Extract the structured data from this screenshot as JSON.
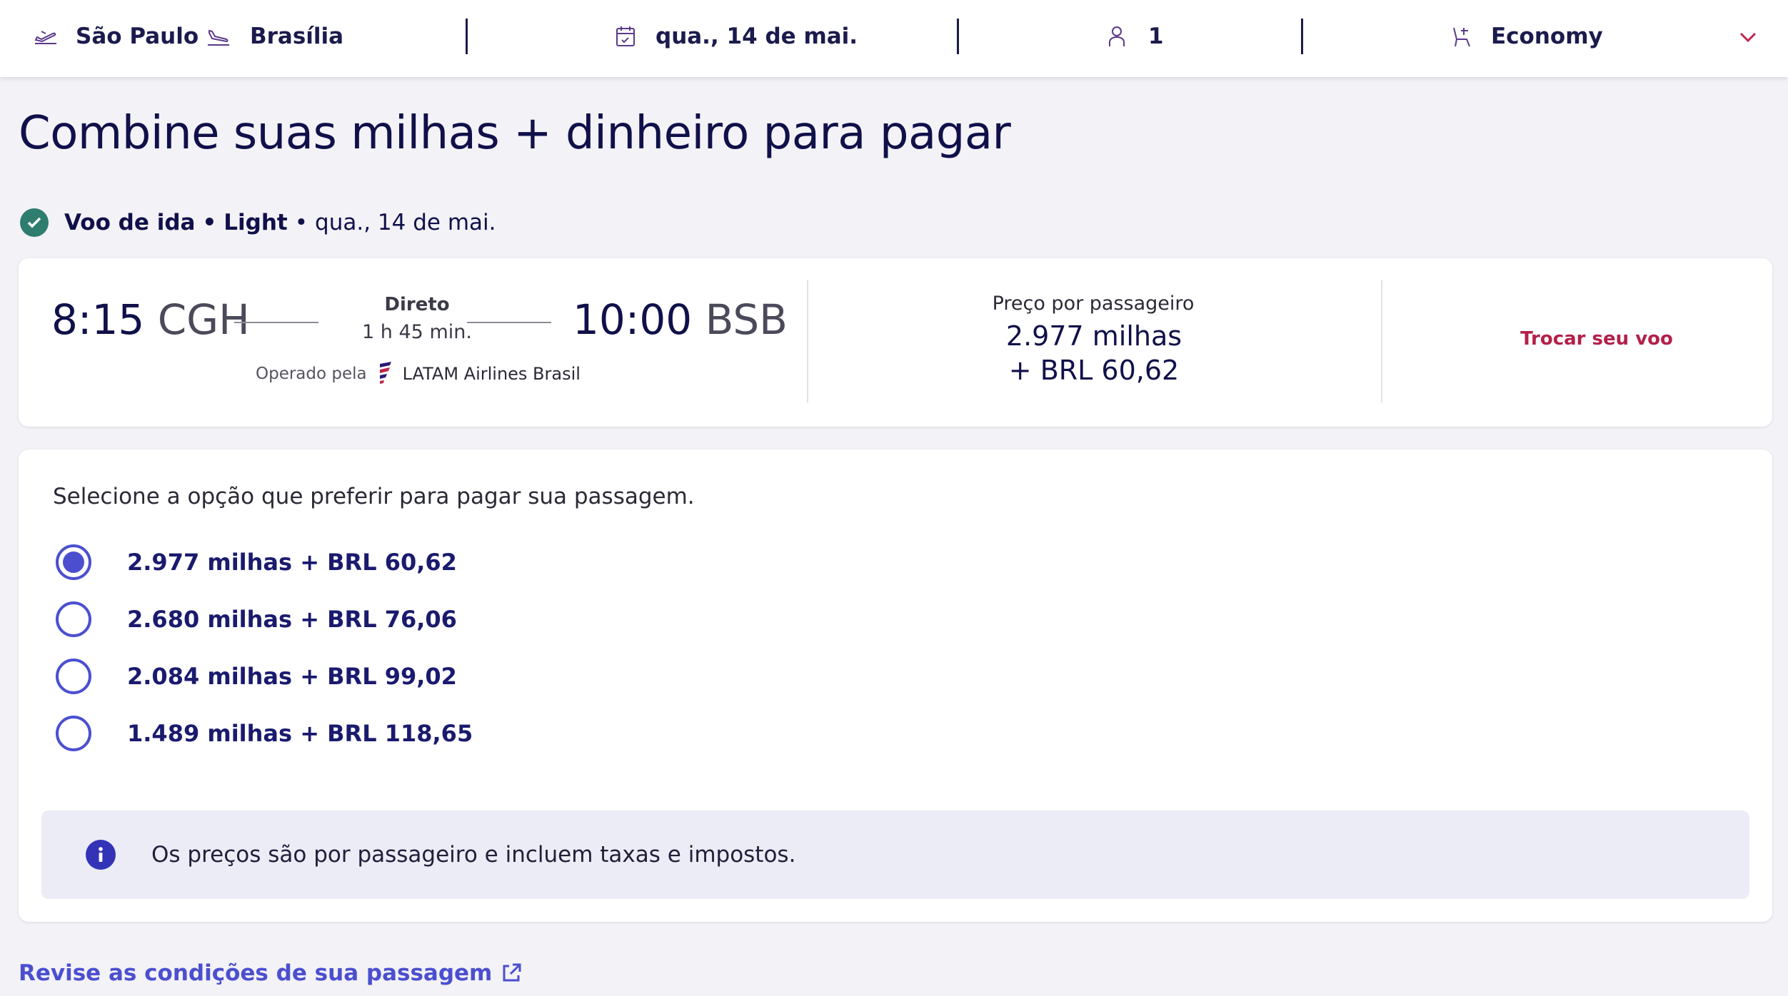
{
  "search_bar": {
    "origin": "São Paulo",
    "destination": "Brasília",
    "date": "qua., 14 de mai.",
    "passengers": "1",
    "cabin": "Economy",
    "icons": {
      "origin": "takeoff-icon",
      "destination": "landing-icon",
      "date": "calendar-icon",
      "passengers": "person-icon",
      "cabin": "seat-icon",
      "expand": "chevron-down-icon"
    }
  },
  "page": {
    "title": "Combine suas milhas + dinheiro para pagar"
  },
  "flight_summary": {
    "leg": "Voo de ida",
    "separator": "•",
    "fare": "Light",
    "date": "qua., 14 de mai."
  },
  "flight": {
    "departure_time": "8:15",
    "departure_airport": "CGH",
    "arrival_time": "10:00",
    "arrival_airport": "BSB",
    "stops": "Direto",
    "duration": "1 h 45 min.",
    "operated_by_label": "Operado pela",
    "operator": "LATAM Airlines Brasil",
    "price_label": "Preço por passageiro",
    "price_miles": "2.977 milhas",
    "price_cash": "+ BRL 60,62",
    "change_flight": "Trocar seu voo"
  },
  "payment": {
    "prompt": "Selecione a opção que preferir para pagar sua passagem.",
    "options": [
      {
        "label": "2.977 milhas + BRL 60,62",
        "selected": true
      },
      {
        "label": "2.680 milhas + BRL 76,06",
        "selected": false
      },
      {
        "label": "2.084 milhas + BRL 99,02",
        "selected": false
      },
      {
        "label": "1.489 milhas + BRL 118,65",
        "selected": false
      }
    ],
    "info": "Os preços são por passageiro e incluem taxas e impostos."
  },
  "footer": {
    "review_link": "Revise as condições de sua passagem"
  },
  "colors": {
    "brand_navy": "#10104a",
    "accent_blue": "#4b4fcf",
    "alert_red": "#b3204a",
    "success_green": "#2e7d6f",
    "background": "#f3f2f7"
  }
}
